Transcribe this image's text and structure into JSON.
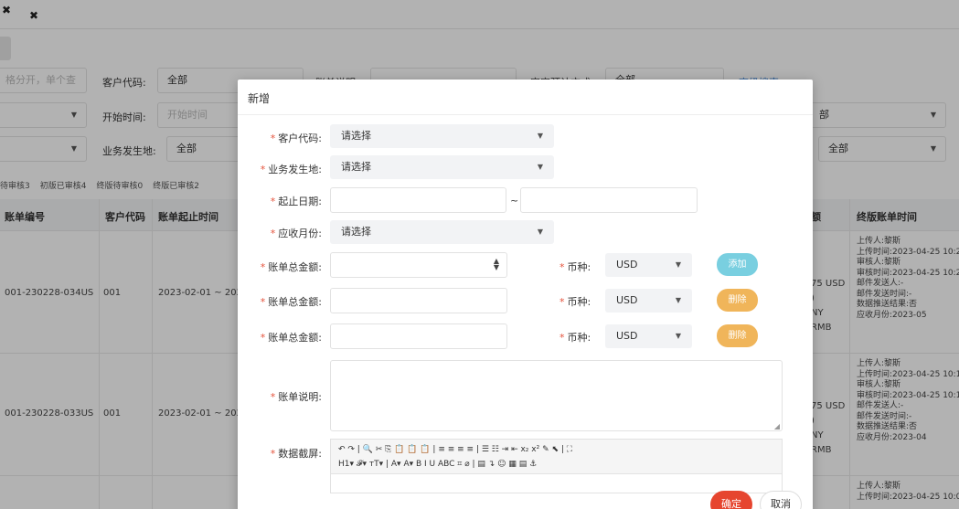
{
  "tabs": {
    "close1": "✖",
    "close2": "✖"
  },
  "filters": {
    "input_placeholder": "格分开，单个查",
    "customer_code_label": "客户代码:",
    "customer_code_value": "全部",
    "bill_desc_label": "账单说明",
    "check_mode_label": "审定预计方式",
    "check_mode_value": "全部",
    "advanced_search": "高级搜索",
    "start_time_label": "开始时间:",
    "start_time_placeholder": "开始时间",
    "right_select_1": "部",
    "business_place_label": "业务发生地:",
    "business_place_value": "全部",
    "right_select_2": "全部"
  },
  "subtabs": [
    "待审核3",
    "初版已审核4",
    "终版待审核0",
    "终版已审核2"
  ],
  "table": {
    "headers": {
      "bill_no": "账单编号",
      "customer": "客户代码",
      "period": "账单起止时间",
      "amount_tail": "额",
      "final_time": "终版账单时间"
    },
    "rows": [
      {
        "bill_no": "001-230228-034US",
        "customer": "001",
        "period": "2023-02-01 ~ 2023",
        "amt1": "75 USD",
        "amt2": ")",
        "amt3": "NY",
        "amt4": "RMB",
        "log": [
          "上传人:黎斯",
          "上传时间:2023-04-25 10:2",
          "审核人:黎斯",
          "审核时间:2023-04-25 10:2",
          "邮件发送人:-",
          "邮件发送时间:-",
          "数据推送结果:否",
          "应收月份:2023-05"
        ]
      },
      {
        "bill_no": "001-230228-033US",
        "customer": "001",
        "period": "2023-02-01 ~ 2023",
        "amt1": "75 USD",
        "amt2": ")",
        "amt3": "NY",
        "amt4": "RMB",
        "log": [
          "上传人:黎斯",
          "上传时间:2023-04-25 10:1",
          "审核人:黎斯",
          "审核时间:2023-04-25 10:1",
          "邮件发送人:-",
          "邮件发送时间:-",
          "数据推送结果:否",
          "应收月份:2023-04"
        ]
      },
      {
        "log": [
          "上传人:黎斯",
          "上传时间:2023-04-25 10:0"
        ]
      }
    ]
  },
  "modal": {
    "title": "新增",
    "customer_code_label": "客户代码:",
    "customer_code_value": "请选择",
    "business_place_label": "业务发生地:",
    "business_place_value": "请选择",
    "date_range_label": "起止日期:",
    "date_sep": "~",
    "receivable_month_label": "应收月份:",
    "receivable_month_value": "请选择",
    "amount_rows": [
      {
        "label": "账单总金额:",
        "currency_label": "币种:",
        "currency": "USD",
        "action": "添加",
        "action_color": "#79cfe0"
      },
      {
        "label": "账单总金额:",
        "currency_label": "币种:",
        "currency": "USD",
        "action": "删除",
        "action_color": "#f0b55a"
      },
      {
        "label": "账单总金额:",
        "currency_label": "币种:",
        "currency": "USD",
        "action": "删除",
        "action_color": "#f0b55a"
      }
    ],
    "bill_desc_label": "账单说明:",
    "screenshot_label": "数据截屏:",
    "editor_toolbar_row1": "↶ ↷ | 🔍 ✂ ⎘ 📋 📋 📋 | ≡ ≡ ≡ ≡ | ☰ ☷ ⇥ ⇤ x₂ x² ✎ ⬉ | ⛶",
    "editor_toolbar_row2": "H1▾  𝓕▾  тT▾ | A▾ A▾ B I U ABC ⌗ ⌀ | ▤ ↴ ☺ ▦ ▤ ⚓",
    "ok": "确定",
    "cancel": "取消",
    "required_star": "*",
    "caret": "▼"
  }
}
